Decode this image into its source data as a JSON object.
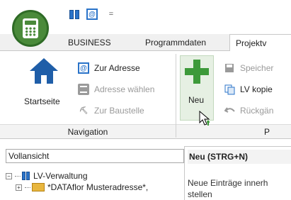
{
  "app": {
    "icon": "calculator-app-icon"
  },
  "quick_access": {
    "lv_icon": "lv-icon",
    "address_icon": "address-icon",
    "more": "="
  },
  "tabs": [
    {
      "label": "BUSINESS"
    },
    {
      "label": "Programmdaten"
    },
    {
      "label": "Projektv"
    }
  ],
  "ribbon": {
    "navigation": {
      "home_label": "Startseite",
      "items": [
        {
          "label": "Zur Adresse",
          "icon": "address-icon",
          "enabled": true
        },
        {
          "label": "Adresse wählen",
          "icon": "card-icon",
          "enabled": false
        },
        {
          "label": "Zur Baustelle",
          "icon": "construction-site-icon",
          "enabled": false
        }
      ],
      "group_label": "Navigation"
    },
    "project": {
      "new_label": "Neu",
      "items": [
        {
          "label": "Speicher",
          "icon": "save-icon",
          "enabled": false
        },
        {
          "label": "LV kopie",
          "icon": "copy-icon",
          "enabled": true
        },
        {
          "label": "Rückgän",
          "icon": "undo-icon",
          "enabled": false
        }
      ],
      "group_label": "P"
    }
  },
  "left_panel": {
    "view": "Vollansicht",
    "tree": [
      {
        "label": "LV-Verwaltung",
        "expander": "−"
      },
      {
        "label": "*DATAflor Musteradresse*,",
        "expander": "+"
      },
      {
        "label": ""
      }
    ]
  },
  "tooltip": {
    "title": "Neu (STRG+N)",
    "line1": "Neue Einträge innerh",
    "line2": "stellen"
  },
  "colors": {
    "accent_green": "#3d9a3a",
    "accent_blue": "#2a73c9"
  }
}
